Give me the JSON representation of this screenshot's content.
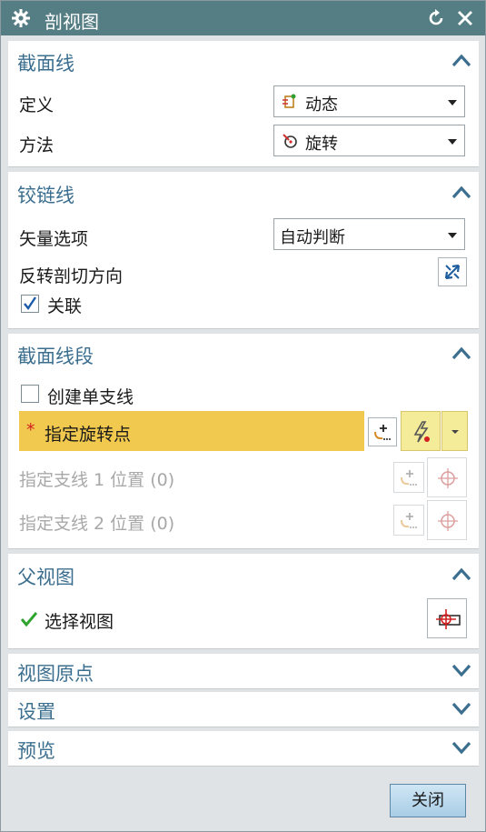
{
  "dialog": {
    "title": "剖视图"
  },
  "sections": {
    "section_line": {
      "title": "截面线",
      "definition_label": "定义",
      "definition_value": "动态",
      "method_label": "方法",
      "method_value": "旋转"
    },
    "hinge_line": {
      "title": "铰链线",
      "vector_label": "矢量选项",
      "vector_value": "自动判断",
      "reverse_label": "反转剖切方向",
      "associative_label": "关联",
      "associative_checked": true
    },
    "section_segment": {
      "title": "截面线段",
      "create_single_label": "创建单支线",
      "create_single_checked": false,
      "required_mark": "*",
      "rotation_point_label": "指定旋转点",
      "branch1_label": "指定支线 1 位置 (0)",
      "branch2_label": "指定支线 2 位置 (0)"
    },
    "parent_view": {
      "title": "父视图",
      "select_view_label": "选择视图"
    },
    "view_origin": {
      "title": "视图原点"
    },
    "settings": {
      "title": "设置"
    },
    "preview": {
      "title": "预览"
    }
  },
  "footer": {
    "close_label": "关闭"
  },
  "colors": {
    "titlebar": "#557d84",
    "section_title": "#3c6f8f",
    "highlight": "#f1c94e",
    "check_green": "#2ea32e",
    "required_red": "#d22020"
  },
  "icons": [
    "gear-icon",
    "reset-icon",
    "close-icon",
    "chevron-up-icon",
    "chevron-down-icon",
    "dynamic-icon",
    "rotate-icon",
    "reverse-direction-icon",
    "point-dialog-icon",
    "point-snap-icon",
    "crosshair-icon",
    "select-view-icon",
    "checkmark-icon"
  ]
}
